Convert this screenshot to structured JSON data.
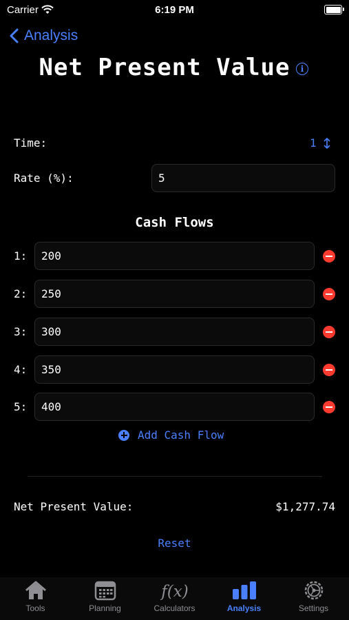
{
  "status": {
    "carrier": "Carrier",
    "time": "6:19 PM"
  },
  "nav": {
    "back_label": "Analysis",
    "title": "Net Present Value"
  },
  "form": {
    "time_label": "Time:",
    "time_value": "1",
    "rate_label": "Rate (%):",
    "rate_value": "5"
  },
  "cash_flows": {
    "heading": "Cash Flows",
    "items": [
      {
        "label": "1:",
        "value": "200"
      },
      {
        "label": "2:",
        "value": "250"
      },
      {
        "label": "3:",
        "value": "300"
      },
      {
        "label": "4:",
        "value": "350"
      },
      {
        "label": "5:",
        "value": "400"
      }
    ],
    "add_label": "Add Cash Flow"
  },
  "result": {
    "label": "Net Present Value:",
    "value": "$1,277.74"
  },
  "reset_label": "Reset",
  "tabs": [
    {
      "label": "Tools",
      "icon": "house-icon"
    },
    {
      "label": "Planning",
      "icon": "calendar-icon"
    },
    {
      "label": "Calculators",
      "icon": "function-icon"
    },
    {
      "label": "Analysis",
      "icon": "bar-chart-icon",
      "active": true
    },
    {
      "label": "Settings",
      "icon": "gear-icon"
    }
  ],
  "colors": {
    "accent": "#4a80ff",
    "destructive": "#ff3b30",
    "background": "#000000"
  }
}
